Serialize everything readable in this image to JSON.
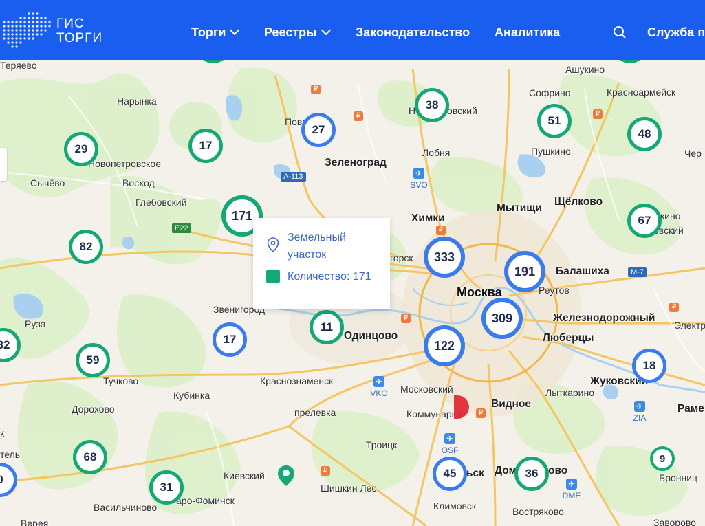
{
  "header": {
    "logo_text_line1": "ГИС",
    "logo_text_line2": "ТОРГИ",
    "nav": [
      {
        "label": "Торги",
        "dropdown": true
      },
      {
        "label": "Реестры",
        "dropdown": true
      },
      {
        "label": "Законодательство",
        "dropdown": false
      },
      {
        "label": "Аналитика",
        "dropdown": false
      }
    ],
    "search_icon": "search-icon",
    "support_label": "Служба п"
  },
  "tooltip": {
    "category": "Земельный участок",
    "count_label": "Количество: 171",
    "swatch_color": "#13a874"
  },
  "clusters": [
    {
      "value": "29"
    },
    {
      "value": "17"
    },
    {
      "value": "27"
    },
    {
      "value": "38"
    },
    {
      "value": "51"
    },
    {
      "value": "48"
    },
    {
      "value": "171"
    },
    {
      "value": "82"
    },
    {
      "value": "333"
    },
    {
      "value": "191"
    },
    {
      "value": "67"
    },
    {
      "value": "309"
    },
    {
      "value": "11"
    },
    {
      "value": "17"
    },
    {
      "value": "122"
    },
    {
      "value": "32"
    },
    {
      "value": "59"
    },
    {
      "value": "18"
    },
    {
      "value": "68"
    },
    {
      "value": "45"
    },
    {
      "value": "36"
    },
    {
      "value": "9"
    },
    {
      "value": "31"
    },
    {
      "value": "0"
    }
  ],
  "places": {
    "teryaevo": "Теряево",
    "narynka": "Нарынка",
    "novopetrovskoe": "Новопетровское",
    "sychevo": "Сычёво",
    "voskhod": "Восход",
    "glebovsky": "Глебовский",
    "ruza": "Руза",
    "tuchkovo": "Тучково",
    "kubinka": "Кубинка",
    "dorokhovo": "Дорохово",
    "vasilchinovo": "Васильчиново",
    "vereya": "Верея",
    "telb": "тель",
    "k": "к",
    "zvenigorod": "Звенигород",
    "krasnoznamensk": "Краснознаменск",
    "aprelevka": "прелевка",
    "kievsky": "Киевский",
    "naro_fominsk": "аро-Фоминск",
    "shishkin_les": "Шишкин Лес",
    "troitsk": "Троицк",
    "klimovsk": "Климовск",
    "odintsovo": "Одинцово",
    "moskovsky": "Московский",
    "kommunarka": "Коммунарка",
    "vidnoe": "Видное",
    "zelenograd": "Зеленоград",
    "lobnya": "Лобня",
    "khimki": "Химки",
    "mytishchi": "Мытищи",
    "shchelkovo": "Щёлково",
    "moskva": "Москва",
    "balashikha": "Балашиха",
    "reutov": "Реутов",
    "zheleznodorozhny": "Железнодорожный",
    "lyubertsy": "Люберцы",
    "elektr": "Электр",
    "lytkarino": "Лыткарино",
    "zhukovsky": "Жуковский",
    "rame": "Раме",
    "bronnitsy": "Бронниц",
    "zavorovo": "Заворово",
    "vostryakovo": "Востряково",
    "domodedovo_part": "Дом",
    "domodedovo_end": "ово",
    "sk": "ьск",
    "sofrino": "Софрино",
    "pushkino": "Пушкино",
    "ashukino": "Ашукино",
    "krasnoarmeysk": "Красноармейск",
    "cher": "Чер",
    "povarovo": "Пова",
    "novy_part": "Н",
    "ovsky": "овский",
    "gorsk": "горск",
    "kino_part": "кино-",
    "ovsky2": "овский",
    "pokrov": "Пова"
  },
  "roads": {
    "a113": "А-113",
    "e22": "E22",
    "m7": "М-7"
  },
  "airports": {
    "svo": "SVO",
    "vko": "VKO",
    "osf": "OSF",
    "dme": "DME",
    "zia": "ZIA"
  },
  "colors": {
    "header": "#1a5ef0",
    "green": "#13a874",
    "blue": "#3b7bf0"
  }
}
